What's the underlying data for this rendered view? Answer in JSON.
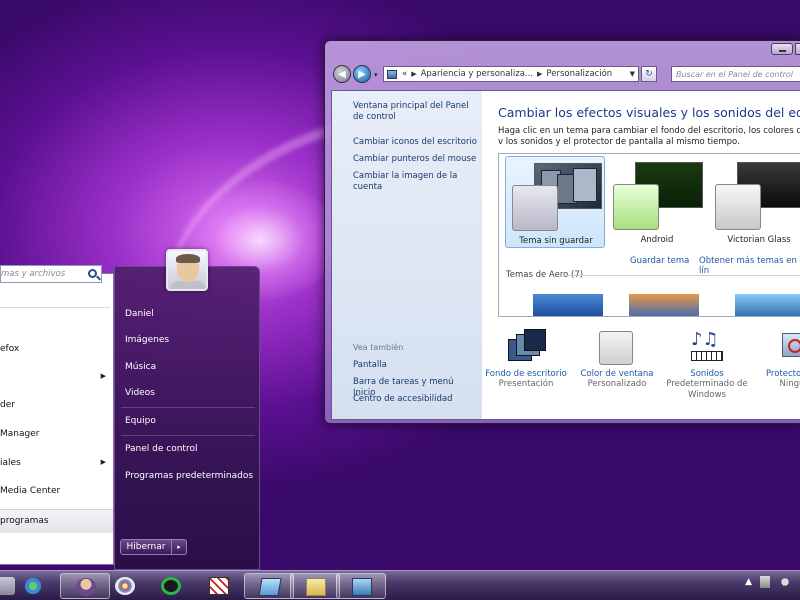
{
  "colors": {
    "link": "#1a5aa8",
    "title": "#1a3a8a",
    "start_right_bg": "#4a1a70"
  },
  "window": {
    "breadcrumb_prefix": "«",
    "breadcrumb_1": "Apariencia y personaliza...",
    "breadcrumb_2": "Personalización",
    "search_placeholder": "Buscar en el Panel de control",
    "left_links": [
      "Ventana principal del Panel de control",
      "Cambiar iconos del escritorio",
      "Cambiar punteros del mouse",
      "Cambiar la imagen de la cuenta"
    ],
    "see_also_label": "Vea también",
    "see_also_links": [
      "Pantalla",
      "Barra de tareas y menú Inicio",
      "Centro de accesibilidad"
    ],
    "main_title": "Cambiar los efectos visuales y los sonidos del equipo",
    "main_desc": "Haga clic en un tema para cambiar el fondo del escritorio, los colores de la v los sonidos y el protector de pantalla al mismo tiempo.",
    "themes": [
      {
        "name": "Tema sin guardar",
        "selected": true
      },
      {
        "name": "Android",
        "selected": false
      },
      {
        "name": "Victorian Glass",
        "selected": false
      }
    ],
    "save_theme_link": "Guardar tema",
    "more_themes_link": "Obtener más temas en lín",
    "aero_label": "Temas de Aero (7)",
    "bottom_items": [
      {
        "label": "Fondo de escritorio",
        "sub": "Presentación",
        "icon": "wallpaper-icon"
      },
      {
        "label": "Color de ventana",
        "sub": "Personalizado",
        "icon": "window-color-icon"
      },
      {
        "label": "Sonidos",
        "sub": "Predeterminado de Windows",
        "icon": "sounds-icon"
      },
      {
        "label": "Protector de",
        "sub": "Ningu",
        "icon": "screensaver-icon"
      }
    ]
  },
  "start_menu": {
    "left_items": [
      {
        "label": "efox",
        "arrow": false
      },
      {
        "label": "",
        "arrow": true
      },
      {
        "label": "der",
        "arrow": false
      },
      {
        "label": "Manager",
        "arrow": false
      },
      {
        "label": "iales",
        "arrow": true
      },
      {
        "label": "Media Center",
        "arrow": false
      }
    ],
    "all_programs": "programas",
    "search_placeholder": "mas y archivos",
    "right_items": [
      "Daniel",
      "Imágenes",
      "Música",
      "Videos",
      "Equipo",
      "Panel de control",
      "Programas predeterminados"
    ],
    "shutdown_label": "Hibernar",
    "shutdown_arrow": "▸"
  },
  "taskbar": {
    "apps": [
      "messenger-icon",
      "user-icon",
      "paint-icon",
      "spotify-icon",
      "app-icon",
      "notepad-icon",
      "explorer-icon",
      "control-panel-icon"
    ]
  }
}
